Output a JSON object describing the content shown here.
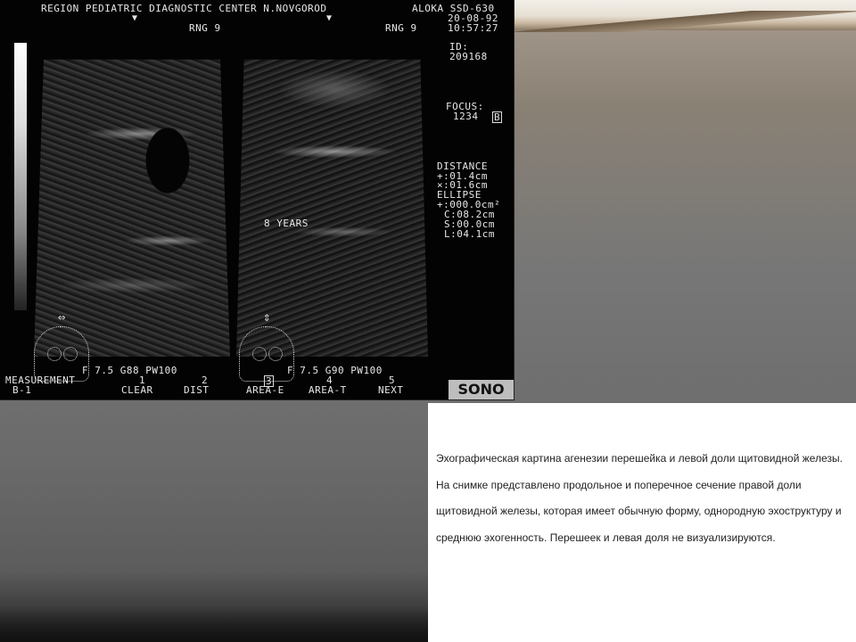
{
  "ultrasound": {
    "header_left": "REGION PEDIATRIC DIAGNOSTIC CENTER N.NOVGOROD",
    "header_right": "ALOKA SSD-630",
    "date": "20-08-92",
    "time": "10:57:27",
    "rng_left": "RNG 9",
    "rng_right": "RNG 9",
    "id_label": "ID:",
    "id_value": "209168",
    "focus_label": "FOCUS:",
    "focus_value": "1234",
    "focus_badge": "B",
    "distance_label": "DISTANCE",
    "distance_1": "+:01.4cm",
    "distance_2": "×:01.6cm",
    "ellipse_label": "ELLIPSE",
    "ellipse_1": "+:000.0cm²",
    "ellipse_c": "C:08.2cm",
    "ellipse_s": "S:00.0cm",
    "ellipse_l": "L:04.1cm",
    "age_label": "8 YEARS",
    "params_left": "F 7.5 G88 PW100",
    "params_right": "F 7.5 G90 PW100",
    "measurement": "MEASUREMENT",
    "mode": "B-1",
    "menu": [
      {
        "num": "1",
        "label": "CLEAR"
      },
      {
        "num": "2",
        "label": "DIST"
      },
      {
        "num": "3",
        "label": "AREA-E"
      },
      {
        "num": "4",
        "label": "AREA-T"
      },
      {
        "num": "5",
        "label": "NEXT"
      }
    ],
    "brand": "SONO"
  },
  "caption": {
    "text": "Эхографическая картина агенезии перешейка и левой доли щитовидной железы. На снимке представлено продольное и поперечное сечение правой доли щитовидной железы, которая имеет обычную форму, однородную эхоструктуру и среднюю эхогенность. Перешеек и левая доля не визуализируются."
  }
}
